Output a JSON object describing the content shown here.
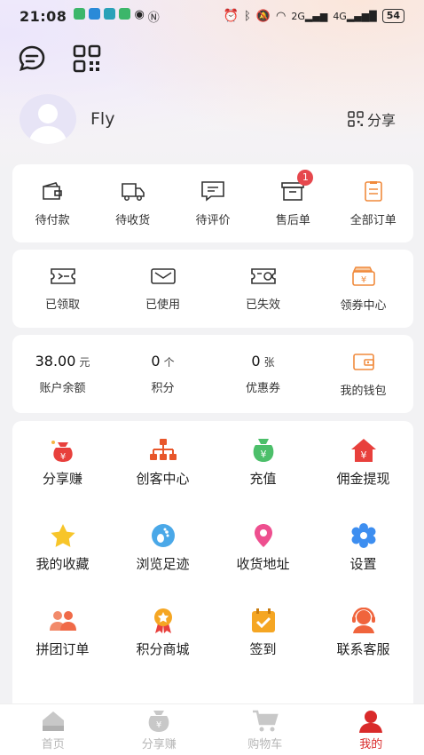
{
  "status": {
    "time": "21:08",
    "net2": "2G",
    "net4": "4G",
    "battery": "54"
  },
  "profile": {
    "name": "Fly",
    "share_label": "分享"
  },
  "orders": [
    {
      "label": "待付款",
      "icon": "wallet-icon"
    },
    {
      "label": "待收货",
      "icon": "truck-icon"
    },
    {
      "label": "待评价",
      "icon": "comment-icon"
    },
    {
      "label": "售后单",
      "icon": "after-sales-icon",
      "badge": "1"
    },
    {
      "label": "全部订单",
      "icon": "order-list-icon"
    }
  ],
  "coupons": [
    {
      "label": "已领取",
      "icon": "ticket-icon"
    },
    {
      "label": "已使用",
      "icon": "ticket-used-icon"
    },
    {
      "label": "已失效",
      "icon": "ticket-expired-icon"
    },
    {
      "label": "领券中心",
      "icon": "coupon-center-icon"
    }
  ],
  "assets": {
    "balance_value": "38.00",
    "balance_unit": "元",
    "balance_label": "账户余额",
    "points_value": "0",
    "points_unit": "个",
    "points_label": "积分",
    "coupon_value": "0",
    "coupon_unit": "张",
    "coupon_label": "优惠券",
    "wallet_label": "我的钱包"
  },
  "services": [
    {
      "label": "分享赚",
      "icon": "money-bag-icon"
    },
    {
      "label": "创客中心",
      "icon": "org-chart-icon"
    },
    {
      "label": "充值",
      "icon": "recharge-icon"
    },
    {
      "label": "佣金提现",
      "icon": "house-yen-icon"
    },
    {
      "label": "我的收藏",
      "icon": "star-icon"
    },
    {
      "label": "浏览足迹",
      "icon": "footprint-icon"
    },
    {
      "label": "收货地址",
      "icon": "location-pin-icon"
    },
    {
      "label": "设置",
      "icon": "gear-icon"
    },
    {
      "label": "拼团订单",
      "icon": "group-icon"
    },
    {
      "label": "积分商城",
      "icon": "medal-icon"
    },
    {
      "label": "签到",
      "icon": "checkin-calendar-icon"
    },
    {
      "label": "联系客服",
      "icon": "customer-service-icon"
    }
  ],
  "tabs": [
    {
      "label": "首页",
      "icon": "home-icon"
    },
    {
      "label": "分享赚",
      "icon": "money-bag-icon"
    },
    {
      "label": "购物车",
      "icon": "cart-icon"
    },
    {
      "label": "我的",
      "icon": "user-icon",
      "active": true
    }
  ],
  "colors": {
    "accent": "#d92a2a",
    "orange": "#f08a3c",
    "badge": "#e6474d"
  }
}
